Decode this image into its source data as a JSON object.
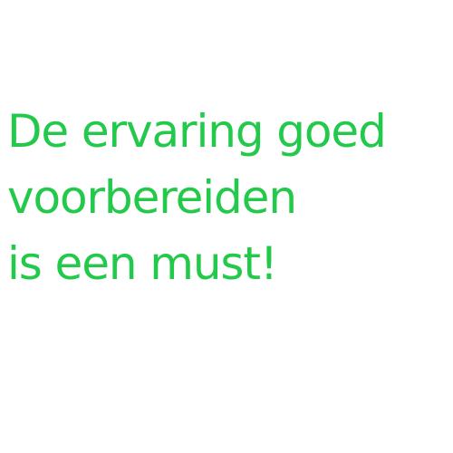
{
  "message": {
    "lines": [
      "De ervaring goed",
      "voorbereiden",
      "is een must!"
    ],
    "color": "#22c94a"
  }
}
